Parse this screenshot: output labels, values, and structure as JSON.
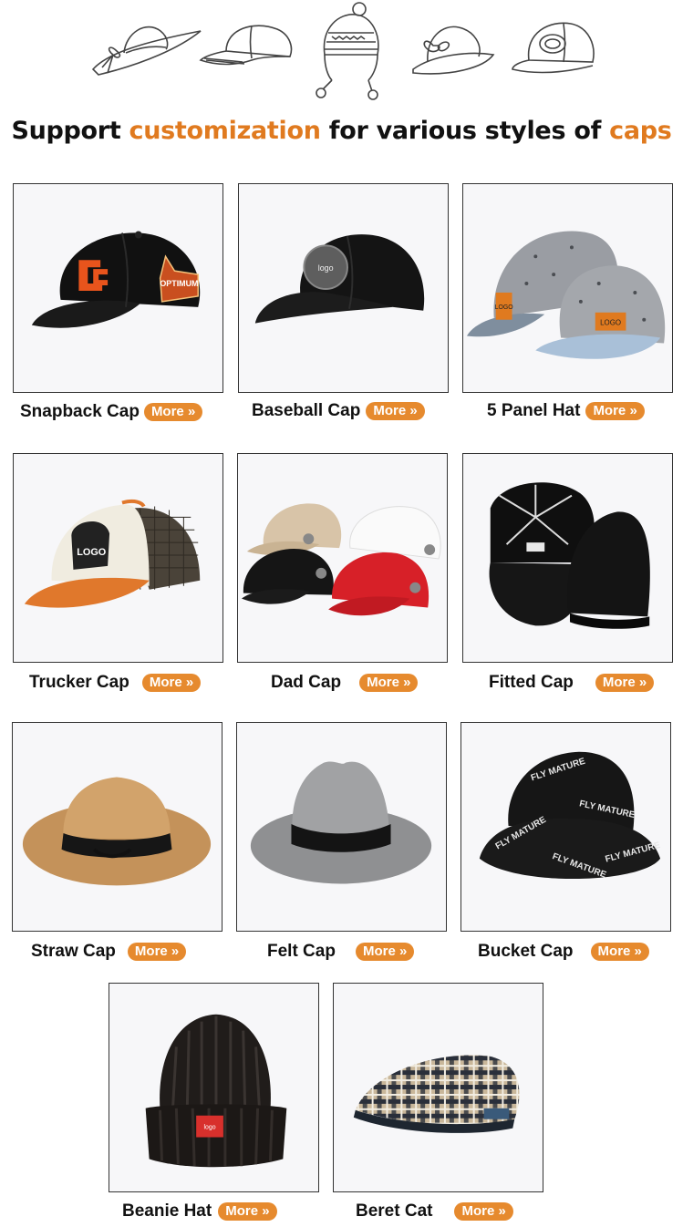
{
  "header": {
    "sketch_icons": [
      "sun-hat-sketch-icon",
      "baseball-cap-sketch-icon",
      "knit-earflap-hat-sketch-icon",
      "bow-hat-sketch-icon",
      "snapback-cap-sketch-icon"
    ],
    "headline_parts": [
      "Support ",
      "customization",
      " for various styles of ",
      "caps"
    ],
    "accent_color": "#e07a1f"
  },
  "more_label": "More »",
  "button_color": "#e68a2e",
  "products": [
    {
      "name": "Snapback Cap",
      "image": "snapback-cap-image",
      "badge_text": "OPTIMUM"
    },
    {
      "name": "Baseball Cap",
      "image": "baseball-cap-image",
      "badge_text": "logo"
    },
    {
      "name": "5 Panel Hat",
      "image": "five-panel-hat-image",
      "badge_text": "LOGO"
    },
    {
      "name": "Trucker Cap",
      "image": "trucker-cap-image",
      "badge_text": "LOGO"
    },
    {
      "name": "Dad Cap",
      "image": "dad-cap-image"
    },
    {
      "name": "Fitted Cap",
      "image": "fitted-cap-image"
    },
    {
      "name": "Straw Cap",
      "image": "straw-cap-image"
    },
    {
      "name": "Felt Cap",
      "image": "felt-cap-image"
    },
    {
      "name": "Bucket Cap",
      "image": "bucket-cap-image",
      "badge_text": "FLY MATURE"
    },
    {
      "name": "Beanie Hat",
      "image": "beanie-hat-image",
      "badge_text": "logo"
    },
    {
      "name": "Beret Cat",
      "image": "beret-cap-image"
    }
  ]
}
